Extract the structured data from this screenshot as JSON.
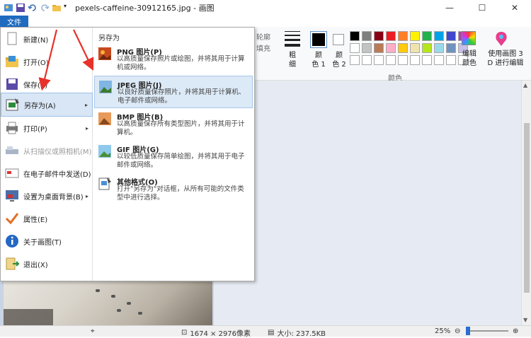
{
  "window": {
    "title": "pexels-caffeine-30912165.jpg - 画图",
    "minimize": "—",
    "maximize": "☐",
    "close": "✕"
  },
  "quick_access": {
    "icons": [
      "paint-app-icon",
      "save-icon",
      "undo-icon",
      "redo-icon",
      "folder-icon",
      "customize-dropdown-icon"
    ]
  },
  "ribbon": {
    "file_tab": "文件",
    "outline_label": "轮廓",
    "fill_label": "填充",
    "size_label": "粗\n细",
    "color1_label": "颜\n色 1",
    "color2_label": "颜\n色 2",
    "palette_group_label": "颜色",
    "edit_colors_label": "编辑\n颜色",
    "paint3d_label": "使用画图 3\nD 进行编辑",
    "palette": [
      "#000000",
      "#7f7f7f",
      "#880015",
      "#ed1c24",
      "#ff7f27",
      "#fff200",
      "#22b14c",
      "#00a2e8",
      "#3f48cc",
      "#a349a4",
      "#ffffff",
      "#c3c3c3",
      "#b97a57",
      "#ffaec9",
      "#ffc90e",
      "#efe4b0",
      "#b5e61d",
      "#99d9ea",
      "#7092be",
      "#c8bfe7",
      "#ffffff",
      "#ffffff",
      "#ffffff",
      "#ffffff",
      "#ffffff",
      "#ffffff",
      "#ffffff",
      "#ffffff",
      "#ffffff",
      "#ffffff"
    ]
  },
  "file_menu": {
    "items": [
      {
        "label": "新建(N)",
        "icon": "new-file-icon",
        "disabled": false,
        "submenu": false
      },
      {
        "label": "打开(O)",
        "icon": "open-folder-icon",
        "disabled": false,
        "submenu": false
      },
      {
        "label": "保存(S)",
        "icon": "save-icon",
        "disabled": false,
        "submenu": false
      },
      {
        "label": "另存为(A)",
        "icon": "save-as-icon",
        "disabled": false,
        "submenu": true,
        "active": true
      },
      {
        "label": "打印(P)",
        "icon": "printer-icon",
        "disabled": false,
        "submenu": true
      },
      {
        "label": "从扫描仪或照相机(M)",
        "icon": "scanner-icon",
        "disabled": true,
        "submenu": false
      },
      {
        "label": "在电子邮件中发送(D)",
        "icon": "email-icon",
        "disabled": false,
        "submenu": false
      },
      {
        "label": "设置为桌面背景(B)",
        "icon": "desktop-background-icon",
        "disabled": false,
        "submenu": true
      },
      {
        "label": "属性(E)",
        "icon": "checkmark-icon",
        "disabled": false,
        "submenu": false
      },
      {
        "label": "关于画图(T)",
        "icon": "info-icon",
        "disabled": false,
        "submenu": false
      },
      {
        "label": "退出(X)",
        "icon": "exit-icon",
        "disabled": false,
        "submenu": false
      }
    ]
  },
  "save_as_menu": {
    "header": "另存为",
    "items": [
      {
        "title": "PNG 图片(P)",
        "desc": "以高质量保存照片或绘图，并将其用于计算机或网络。",
        "icon": "png-image-icon"
      },
      {
        "title": "JPEG 图片(J)",
        "desc": "以良好质量保存照片，并将其用于计算机、电子邮件或网络。",
        "icon": "jpeg-image-icon",
        "active": true
      },
      {
        "title": "BMP 图片(B)",
        "desc": "以高质量保存所有类型图片，并将其用于计算机。",
        "icon": "bmp-image-icon"
      },
      {
        "title": "GIF 图片(G)",
        "desc": "以较低质量保存简单绘图，并将其用于电子邮件或网络。",
        "icon": "gif-image-icon"
      },
      {
        "title": "其他格式(O)",
        "desc": "打开\"另存为\"对话框，从所有可能的文件类型中进行选择。",
        "icon": "other-formats-icon"
      }
    ]
  },
  "status": {
    "dimensions": "1674 × 2976像素",
    "size": "大小: 237.5KB",
    "zoom": "25%",
    "zoom_out": "⊖",
    "zoom_in": "⊕"
  }
}
